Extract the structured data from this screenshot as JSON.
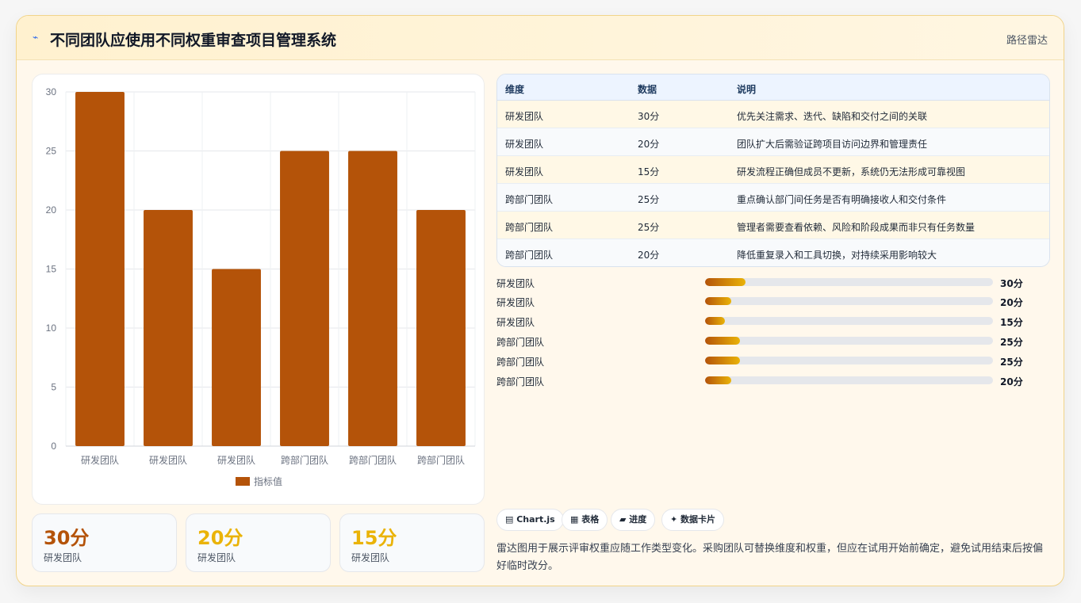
{
  "header": {
    "logo_icon": "⌁",
    "title": "不同团队应使用不同权重审查项目管理系统",
    "tag": "路径雷达"
  },
  "chart_data": {
    "type": "bar",
    "categories": [
      "研发团队",
      "研发团队",
      "研发团队",
      "跨部门团队",
      "跨部门团队",
      "跨部门团队"
    ],
    "series": [
      {
        "name": "指标值",
        "values": [
          30,
          20,
          15,
          25,
          25,
          20
        ],
        "color": "#b45309"
      }
    ],
    "ylim": [
      0,
      30
    ],
    "yticks": [
      0,
      5,
      10,
      15,
      20,
      25,
      30
    ],
    "grid": true,
    "legend": "bottom"
  },
  "stats": [
    {
      "value": "30分",
      "label": "研发团队",
      "color": "#b45309"
    },
    {
      "value": "20分",
      "label": "研发团队",
      "color": "#eab308"
    },
    {
      "value": "15分",
      "label": "研发团队",
      "color": "#eab308"
    }
  ],
  "table": {
    "headers": [
      "维度",
      "数据",
      "说明"
    ],
    "rows": [
      [
        "研发团队",
        "30分",
        "优先关注需求、迭代、缺陷和交付之间的关联"
      ],
      [
        "研发团队",
        "20分",
        "团队扩大后需验证跨项目访问边界和管理责任"
      ],
      [
        "研发团队",
        "15分",
        "研发流程正确但成员不更新，系统仍无法形成可靠视图"
      ],
      [
        "跨部门团队",
        "25分",
        "重点确认部门间任务是否有明确接收人和交付条件"
      ],
      [
        "跨部门团队",
        "25分",
        "管理者需要查看依赖、风险和阶段成果而非只有任务数量"
      ],
      [
        "跨部门团队",
        "20分",
        "降低重复录入和工具切换，对持续采用影响较大"
      ]
    ]
  },
  "progress": [
    {
      "label": "研发团队",
      "value": "30分",
      "fraction": 0.14
    },
    {
      "label": "研发团队",
      "value": "20分",
      "fraction": 0.09
    },
    {
      "label": "研发团队",
      "value": "15分",
      "fraction": 0.07
    },
    {
      "label": "跨部门团队",
      "value": "25分",
      "fraction": 0.12
    },
    {
      "label": "跨部门团队",
      "value": "25分",
      "fraction": 0.12
    },
    {
      "label": "跨部门团队",
      "value": "20分",
      "fraction": 0.09
    }
  ],
  "chips": [
    "▤ Chart.js",
    "▦ 表格",
    "▰ 进度",
    "✦ 数据卡片"
  ],
  "note": "雷达图用于展示评审权重应随工作类型变化。采购团队可替换维度和权重，但应在试用开始前确定，避免试用结束后按偏好临时改分。"
}
